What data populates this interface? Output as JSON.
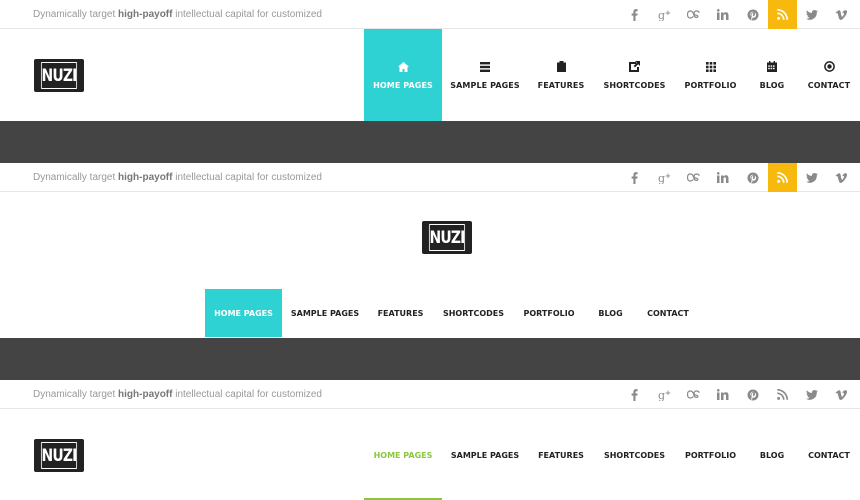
{
  "tagline": {
    "prefix": "Dynamically target ",
    "bold": "high-payoff",
    "suffix": " intellectual capital for customized"
  },
  "social": [
    {
      "name": "facebook-icon"
    },
    {
      "name": "google-plus-icon"
    },
    {
      "name": "lastfm-icon"
    },
    {
      "name": "linkedin-icon"
    },
    {
      "name": "pinterest-icon"
    },
    {
      "name": "rss-icon"
    },
    {
      "name": "twitter-icon"
    },
    {
      "name": "vimeo-icon"
    }
  ],
  "logo": {
    "text": "NUZI"
  },
  "nav": {
    "items": [
      {
        "label": "HOME PAGES",
        "icon": "home-icon"
      },
      {
        "label": "SAMPLE PAGES",
        "icon": "list-icon"
      },
      {
        "label": "FEATURES",
        "icon": "clipboard-icon"
      },
      {
        "label": "SHORTCODES",
        "icon": "share-box-icon"
      },
      {
        "label": "PORTFOLIO",
        "icon": "grid-icon"
      },
      {
        "label": "BLOG",
        "icon": "calendar-icon"
      },
      {
        "label": "CONTACT",
        "icon": "target-icon"
      }
    ]
  },
  "colors": {
    "accent_teal": "#2fd2d2",
    "accent_yellow": "#f7b90e",
    "accent_green": "#8cc63f",
    "band": "#444444"
  }
}
